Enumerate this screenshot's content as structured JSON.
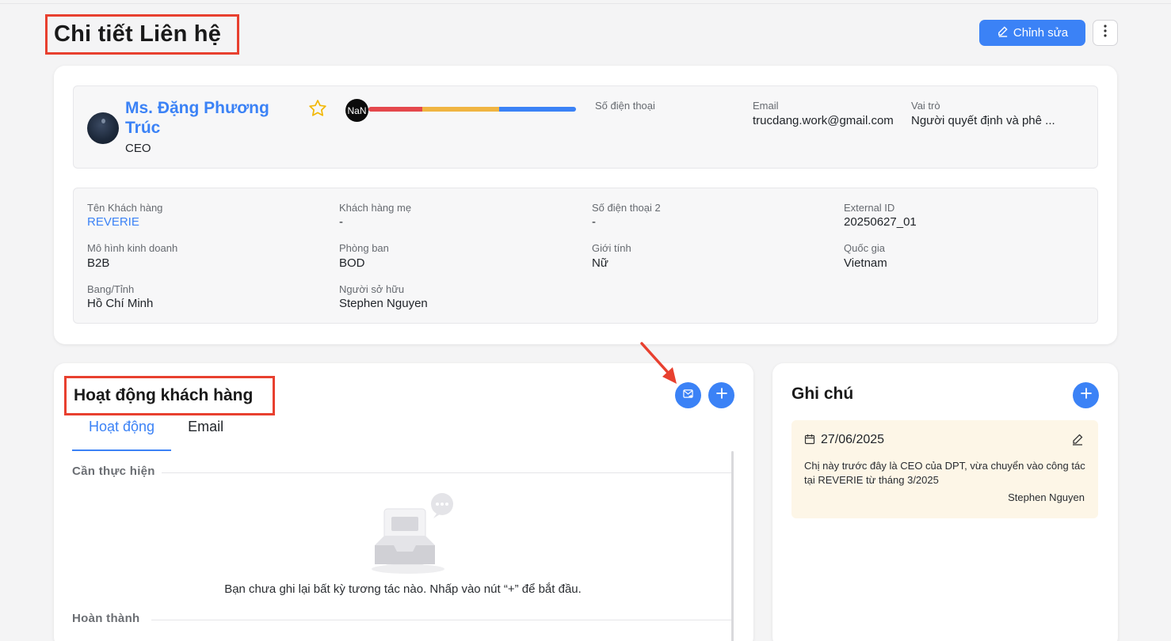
{
  "page": {
    "title": "Chi tiết Liên hệ",
    "edit_label": "Chỉnh sửa",
    "more_icon": "more-vertical-icon"
  },
  "colors": {
    "accent": "#3b82f6",
    "highlight_border": "#e8402f",
    "note_bg": "#fdf6e7"
  },
  "profile": {
    "name": "Ms. Đặng Phương Trúc",
    "title": "CEO",
    "score_text": "NaN",
    "score_segments": [
      {
        "color": "#e5484d",
        "fraction": 0.26
      },
      {
        "color": "#f0b542",
        "fraction": 0.37
      },
      {
        "color": "#3b82f6",
        "fraction": 0.37
      }
    ],
    "phone_label": "Số điện thoại",
    "phone_value": "",
    "email_label": "Email",
    "email_value": "trucdang.work@gmail.com",
    "role_label": "Vai trò",
    "role_value": "Người quyết định và phê ..."
  },
  "details": {
    "customer_label": "Tên Khách hàng",
    "customer_value": "REVERIE",
    "parent_label": "Khách hàng mẹ",
    "parent_value": "-",
    "phone2_label": "Số điện thoại 2",
    "phone2_value": "-",
    "external_label": "External ID",
    "external_value": "20250627_01",
    "model_label": "Mô hình kinh doanh",
    "model_value": "B2B",
    "department_label": "Phòng ban",
    "department_value": "BOD",
    "gender_label": "Giới tính",
    "gender_value": "Nữ",
    "country_label": "Quốc gia",
    "country_value": "Vietnam",
    "state_label": "Bang/Tỉnh",
    "state_value": "Hồ Chí Minh",
    "owner_label": "Người sở hữu",
    "owner_value": "Stephen Nguyen"
  },
  "activity": {
    "title": "Hoạt động khách hàng",
    "tabs": [
      {
        "label": "Hoạt động",
        "active": true
      },
      {
        "label": "Email",
        "active": false
      }
    ],
    "todo_label": "Cần thực hiện",
    "empty_message": "Bạn chưa ghi lại bất kỳ tương tác nào. Nhấp vào nút “+” để bắt đầu.",
    "done_label": "Hoàn thành"
  },
  "notes": {
    "title": "Ghi chú",
    "items": [
      {
        "date": "27/06/2025",
        "body": "Chị này trước đây là CEO của DPT, vừa chuyển vào công tác tại REVERIE từ tháng 3/2025",
        "author": "Stephen Nguyen"
      }
    ]
  }
}
